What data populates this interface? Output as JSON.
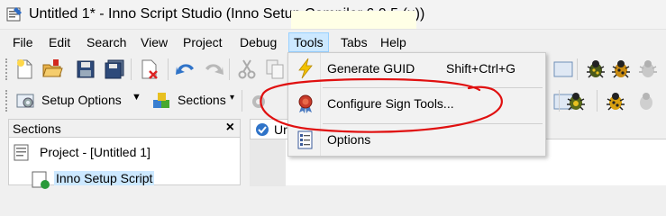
{
  "window": {
    "title": "Untitled 1* - Inno Script Studio (Inno Setup Compiler 6.0.5 (u))"
  },
  "menubar": {
    "items": [
      {
        "label": "File"
      },
      {
        "label": "Edit"
      },
      {
        "label": "Search"
      },
      {
        "label": "View"
      },
      {
        "label": "Project"
      },
      {
        "label": "Debug"
      },
      {
        "label": "Tools",
        "active": true
      },
      {
        "label": "Tabs"
      },
      {
        "label": "Help"
      }
    ]
  },
  "toolbar": {
    "setup_options_label": "Setup Options",
    "sections_label": "Sections"
  },
  "sections_panel": {
    "title": "Sections",
    "close_glyph": "×",
    "tree": [
      {
        "label": "Project - [Untitled 1]"
      },
      {
        "label": "Inno Setup Script"
      }
    ]
  },
  "editor": {
    "tab_label": "Ur"
  },
  "tools_menu": {
    "items": [
      {
        "label": "Generate GUID",
        "shortcut": "Shift+Ctrl+G",
        "icon": "lightning-bolt-icon"
      },
      {
        "label": "Configure Sign Tools...",
        "shortcut": "",
        "icon": "sign-tools-icon"
      },
      {
        "label": "Options",
        "shortcut": "",
        "icon": "options-icon"
      }
    ]
  },
  "colors": {
    "menu_highlight": "#cce8ff",
    "annotation_red": "#e01010"
  }
}
